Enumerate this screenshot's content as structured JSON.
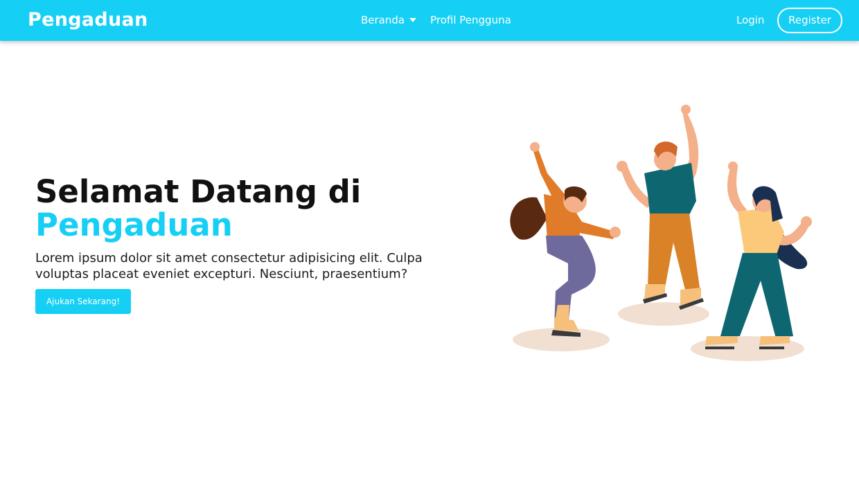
{
  "navbar": {
    "brand": "Pengaduan",
    "menu": [
      {
        "label": "Beranda",
        "has_dropdown": true
      },
      {
        "label": "Profil Pengguna",
        "has_dropdown": false
      }
    ],
    "login_label": "Login",
    "register_label": "Register"
  },
  "hero": {
    "title_line1": "Selamat Datang di",
    "title_line2": "Pengaduan",
    "description": "Lorem ipsum dolor sit amet consectetur adipisicing elit. Culpa voluptas placeat eveniet excepturi. Nesciunt, praesentium?",
    "cta_label": "Ajukan Sekarang!"
  },
  "colors": {
    "primary": "#16cff5",
    "text_dark": "#111111",
    "background": "#ffffff"
  },
  "icons": {
    "dropdown": "caret-down-icon"
  }
}
